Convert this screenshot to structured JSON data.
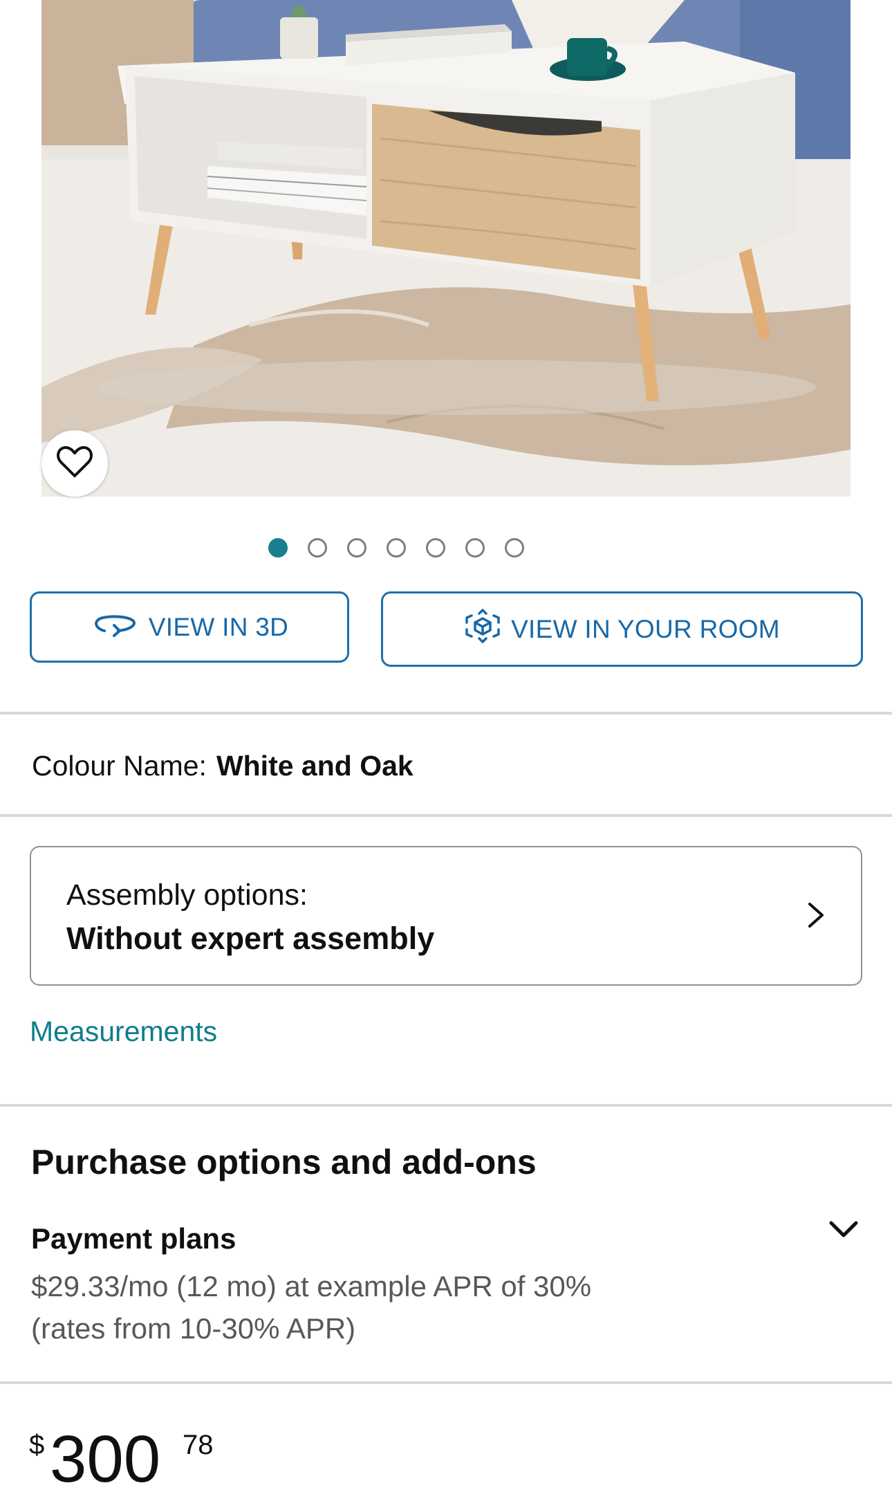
{
  "carousel": {
    "total": 7,
    "active_index": 0
  },
  "view_buttons": {
    "view_3d_label": "VIEW IN 3D",
    "view_room_label": "VIEW IN YOUR ROOM"
  },
  "colour": {
    "label": "Colour Name:",
    "value": "White and Oak"
  },
  "assembly": {
    "label": "Assembly options:",
    "value": "Without expert assembly"
  },
  "measurements_link": "Measurements",
  "purchase": {
    "title": "Purchase options and add-ons",
    "payment_plans": {
      "title": "Payment plans",
      "line1": "$29.33/mo (12 mo) at example APR of 30%",
      "line2": "(rates from 10-30% APR)"
    }
  },
  "price": {
    "currency": "$",
    "whole": "300",
    "fraction": "78"
  },
  "icons": {
    "wishlist": "heart-icon",
    "view_3d": "rotate-3d-icon",
    "view_room": "ar-cube-icon",
    "assembly": "chevron-right-icon",
    "payment_plans": "chevron-down-icon"
  },
  "colors": {
    "accent_teal": "#1a7f8e",
    "button_blue": "#1768a8",
    "divider": "#d5d9d9"
  }
}
